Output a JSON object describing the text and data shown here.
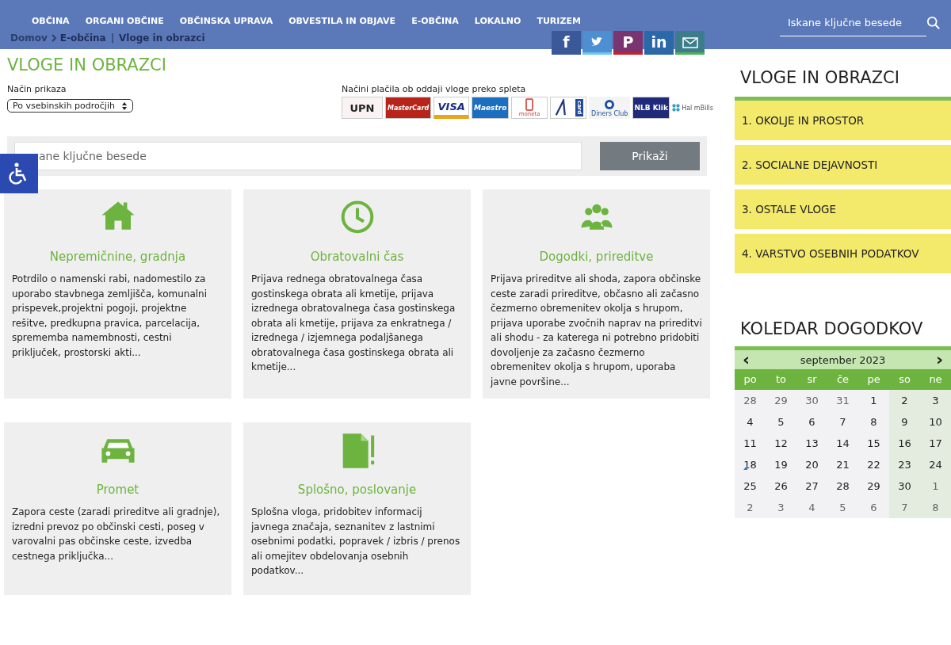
{
  "nav": {
    "items": [
      "OBČINA",
      "ORGANI OBČINE",
      "OBČINSKA UPRAVA",
      "OBVESTILA IN OBJAVE",
      "E-OBČINA",
      "LOKALNO",
      "TURIZEM"
    ],
    "search_placeholder": "Iskane ključne besede"
  },
  "breadcrumb": [
    "Domov",
    "E-občina",
    "Vloge in obrazci"
  ],
  "breadcrumb_separator": "|",
  "share": [
    {
      "kind": "facebook",
      "label": "f"
    },
    {
      "kind": "twitter"
    },
    {
      "kind": "pinterest",
      "label": "P"
    },
    {
      "kind": "linkedin",
      "label": "in"
    },
    {
      "kind": "email"
    }
  ],
  "page_title": "VLOGE IN OBRAZCI",
  "display_mode": {
    "label": "Način prikaza",
    "value": "Po vsebinskih področjih"
  },
  "payments": {
    "label": "Načini plačila ob oddaji vloge preko spleta",
    "methods": [
      {
        "kind": "upn",
        "label": "UPN"
      },
      {
        "kind": "mastercard",
        "label": "MasterCard"
      },
      {
        "kind": "visa",
        "label": "VISA"
      },
      {
        "kind": "maestro",
        "label": "Maestro"
      },
      {
        "kind": "moneta",
        "label": "moneta"
      },
      {
        "kind": "acard",
        "label": "card"
      },
      {
        "kind": "diners",
        "label": "Diners Club"
      },
      {
        "kind": "nlb",
        "label": "NLB Klik"
      },
      {
        "kind": "hal",
        "label": "Hal mBills"
      }
    ]
  },
  "search": {
    "placeholder": "ane ključne besede",
    "button": "Prikaži"
  },
  "categories": [
    {
      "kind": "house",
      "title": "Nepremičnine, gradnja",
      "text": "Potrdilo o namenski rabi, nadomestilo za uporabo stavbnega zemljišča, komunalni prispevek,projektni pogoji, projektne rešitve, predkupna pravica, parcelacija, sprememba namembnosti, cestni priključek, prostorski akti..."
    },
    {
      "kind": "clock",
      "title": "Obratovalni čas",
      "text": "Prijava rednega obratovalnega časa gostinskega obrata ali kmetije, prijava izrednega obratovalnega časa gostinskega obrata ali kmetije, prijava za enkratnega / izrednega / izjemnega podaljšanega obratovalnega časa gostinskega obrata ali kmetije..."
    },
    {
      "kind": "people",
      "title": "Dogodki, prireditve",
      "text": "Prijava prireditve ali shoda, zapora občinske ceste zaradi prireditve, občasno ali začasno čezmerno obremenitev okolja s hrupom, prijava uporabe zvočnih naprav na prireditvi ali shodu - za katerega ni potrebno pridobiti dovoljenje za začasno čezmerno obremenitev okolja s hrupom, uporaba javne površine..."
    },
    {
      "kind": "car",
      "title": "Promet",
      "text": "Zapora ceste (zaradi prireditve ali gradnje), izredni prevoz po občinski cesti, poseg v varovalni pas občinske ceste, izvedba cestnega priključka..."
    },
    {
      "kind": "document",
      "title": "Splošno, poslovanje",
      "text": "Splošna vloga, pridobitev informacij javnega značaja, seznanitev z lastnimi osebnimi podatki, popravek / izbris / prenos ali omejitev obdelovanja osebnih podatkov..."
    }
  ],
  "sidebar": {
    "title": "VLOGE IN OBRAZCI",
    "items": [
      "1. OKOLJE IN PROSTOR",
      "2. SOCIALNE DEJAVNOSTI",
      "3. OSTALE VLOGE",
      "4. VARSTVO OSEBNIH PODATKOV"
    ]
  },
  "calendar": {
    "title": "KOLEDAR DOGODKOV",
    "prev": "‹",
    "next": "›",
    "month": "september 2023",
    "weekdays": [
      "po",
      "to",
      "sr",
      "če",
      "pe",
      "so",
      "ne"
    ],
    "days": [
      {
        "day": "28",
        "other_month": true,
        "event": false
      },
      {
        "day": "29",
        "other_month": true,
        "event": false
      },
      {
        "day": "30",
        "other_month": true,
        "event": false
      },
      {
        "day": "31",
        "other_month": true,
        "event": false
      },
      {
        "day": "1",
        "other_month": false,
        "event": false
      },
      {
        "day": "2",
        "other_month": false,
        "event": false
      },
      {
        "day": "3",
        "other_month": false,
        "event": false
      },
      {
        "day": "4",
        "other_month": false,
        "event": false
      },
      {
        "day": "5",
        "other_month": false,
        "event": false
      },
      {
        "day": "6",
        "other_month": false,
        "event": false
      },
      {
        "day": "7",
        "other_month": false,
        "event": false
      },
      {
        "day": "8",
        "other_month": false,
        "event": false
      },
      {
        "day": "9",
        "other_month": false,
        "event": false
      },
      {
        "day": "10",
        "other_month": false,
        "event": false
      },
      {
        "day": "11",
        "other_month": false,
        "event": false
      },
      {
        "day": "12",
        "other_month": false,
        "event": false
      },
      {
        "day": "13",
        "other_month": false,
        "event": false
      },
      {
        "day": "14",
        "other_month": false,
        "event": false
      },
      {
        "day": "15",
        "other_month": false,
        "event": false
      },
      {
        "day": "16",
        "other_month": false,
        "event": false
      },
      {
        "day": "17",
        "other_month": false,
        "event": false
      },
      {
        "day": "18",
        "other_month": false,
        "event": true
      },
      {
        "day": "19",
        "other_month": false,
        "event": false
      },
      {
        "day": "20",
        "other_month": false,
        "event": false
      },
      {
        "day": "21",
        "other_month": false,
        "event": false
      },
      {
        "day": "22",
        "other_month": false,
        "event": false
      },
      {
        "day": "23",
        "other_month": false,
        "event": false
      },
      {
        "day": "24",
        "other_month": false,
        "event": false
      },
      {
        "day": "25",
        "other_month": false,
        "event": false
      },
      {
        "day": "26",
        "other_month": false,
        "event": false
      },
      {
        "day": "27",
        "other_month": false,
        "event": false
      },
      {
        "day": "28",
        "other_month": false,
        "event": false
      },
      {
        "day": "29",
        "other_month": false,
        "event": false
      },
      {
        "day": "30",
        "other_month": false,
        "event": false
      },
      {
        "day": "1",
        "other_month": true,
        "event": false
      },
      {
        "day": "2",
        "other_month": true,
        "event": false
      },
      {
        "day": "3",
        "other_month": true,
        "event": false
      },
      {
        "day": "4",
        "other_month": true,
        "event": false
      },
      {
        "day": "5",
        "other_month": true,
        "event": false
      },
      {
        "day": "6",
        "other_month": true,
        "event": false
      },
      {
        "day": "7",
        "other_month": true,
        "event": false
      },
      {
        "day": "8",
        "other_month": true,
        "event": false
      }
    ]
  }
}
